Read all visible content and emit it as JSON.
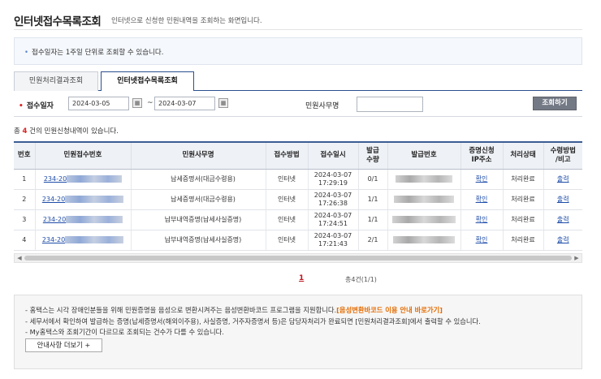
{
  "header": {
    "title": "인터넷접수목록조회",
    "subtitle": "인터넷으로 신청한 민원내역을 조회하는 화면입니다."
  },
  "info": {
    "text": "접수일자는 1주일 단위로 조회할 수 있습니다."
  },
  "tabs": [
    {
      "label": "민원처리결과조회",
      "active": false
    },
    {
      "label": "인터넷접수목록조회",
      "active": true
    }
  ],
  "search": {
    "date_label": "접수일자",
    "required_mark": "•",
    "start_date": "2024-03-05",
    "tilde": "~",
    "end_date": "2024-03-07",
    "name_label": "민원사무명",
    "name_value": "",
    "button_label": "조회하기"
  },
  "result": {
    "prefix": "총 ",
    "count": "4",
    "suffix": " 건의 민원신청내역이 있습니다."
  },
  "table": {
    "headers": [
      "번호",
      "민원접수번호",
      "민원사무명",
      "접수방법",
      "접수일시",
      "발급\n수량",
      "발급번호",
      "증명신청\nIP주소",
      "처리상태",
      "수령방법\n/비고"
    ],
    "rows": [
      {
        "no": "1",
        "receipt": "234-20",
        "name": "납세증명서(대금수령용)",
        "method": "인터넷",
        "date": "2024-03-07",
        "time": "17:29:19",
        "qty": "0/1",
        "ip": "확인",
        "status": "처리완료",
        "output": "출력"
      },
      {
        "no": "2",
        "receipt": "234-20",
        "name": "납세증명서(대금수령용)",
        "method": "인터넷",
        "date": "2024-03-07",
        "time": "17:26:38",
        "qty": "1/1",
        "ip": "확인",
        "status": "처리완료",
        "output": "출력"
      },
      {
        "no": "3",
        "receipt": "234-20",
        "name": "납부내역증명(납세사실증명)",
        "method": "인터넷",
        "date": "2024-03-07",
        "time": "17:24:51",
        "qty": "1/1",
        "ip": "확인",
        "status": "처리완료",
        "output": "출력"
      },
      {
        "no": "4",
        "receipt": "234-20",
        "name": "납부내역증명(납세사실증명)",
        "method": "인터넷",
        "date": "2024-03-07",
        "time": "17:21:43",
        "qty": "2/1",
        "ip": "확인",
        "status": "처리완료",
        "output": "출력"
      }
    ]
  },
  "pagination": {
    "current": "1",
    "total": "총4건(1/1)"
  },
  "notice": {
    "line1_pre": "- 홈택스는 시각 장애인분들을 위해 민원증명을 음성으로 변환시켜주는 음성변환바코드 프로그램을 지원합니다.",
    "line1_link": "[음성변환바코드 이용 안내 바로가기]",
    "line2": "- 세무서에서 확인하여 발급하는 증명(납세증명서(해외이주용), 사실증명, 거주자증명서 등)은 담당자처리가 완료되면 [민원처리결과조회]에서 출력할 수 있습니다.",
    "line3": "- My홈택스와 조회기간이 다르므로 조회되는 건수가 다를 수 있습니다.",
    "more_button": "안내사항 더보기 +"
  },
  "icons": {
    "calendar": "calendar-icon",
    "scroll_left": "arrow-left-icon",
    "scroll_right": "arrow-right-icon"
  },
  "colors": {
    "accent": "#2a4f8f",
    "required": "#dd2222",
    "highlight": "#e56b00",
    "link": "#1e4ca8"
  }
}
